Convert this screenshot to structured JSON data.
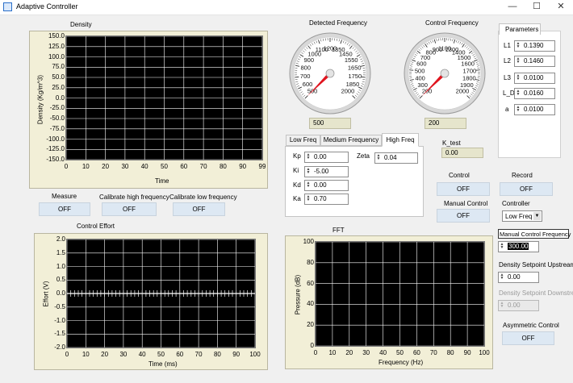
{
  "window": {
    "title": "Adaptive Controller",
    "minimize": "—",
    "maximize": "☐",
    "close": "✕"
  },
  "density_plot": {
    "title": "Density",
    "xlabel": "Time",
    "ylabel": "Density (Kg/m^3)",
    "yticks": [
      "150.0",
      "125.0",
      "100.0",
      "75.0",
      "50.0",
      "25.0",
      "0.0",
      "-25.0",
      "-50.0",
      "-75.0",
      "-100.0",
      "-125.0",
      "-150.0"
    ],
    "xticks": [
      "0",
      "10",
      "20",
      "30",
      "40",
      "50",
      "60",
      "70",
      "80",
      "90",
      "99"
    ]
  },
  "measure": {
    "label": "Measure",
    "value": "OFF"
  },
  "cal_high": {
    "label": "Calibrate high frequency",
    "value": "OFF"
  },
  "cal_low": {
    "label": "Calibrate low frequency",
    "value": "OFF"
  },
  "effort_plot": {
    "title": "Control Effort",
    "xlabel": "Time (ms)",
    "ylabel": "Effort (V)",
    "yticks": [
      "2.0",
      "1.5",
      "1.0",
      "0.5",
      "0.0",
      "-0.5",
      "-1.0",
      "-1.5",
      "-2.0"
    ],
    "xticks": [
      "0",
      "10",
      "20",
      "30",
      "40",
      "50",
      "60",
      "70",
      "80",
      "90",
      "100"
    ]
  },
  "fft_plot": {
    "title": "FFT",
    "xlabel": "Frequency (Hz)",
    "ylabel": "Pressure (dB)",
    "yticks": [
      "100",
      "80",
      "60",
      "40",
      "20",
      "0"
    ],
    "xticks": [
      "0",
      "10",
      "20",
      "30",
      "40",
      "50",
      "60",
      "70",
      "80",
      "90",
      "100"
    ]
  },
  "detected_gauge": {
    "title": "Detected Frequency",
    "scale": [
      "500",
      "600",
      "700",
      "800",
      "900",
      "1000",
      "1100",
      "1200",
      "1350",
      "1450",
      "1550",
      "1650",
      "1750",
      "1850",
      "2000"
    ],
    "readout": "500",
    "value": 500
  },
  "control_gauge": {
    "title": "Control Frequency",
    "scale": [
      "200",
      "300",
      "400",
      "500",
      "600",
      "700",
      "800",
      "900",
      "1100",
      "1300",
      "1400",
      "1500",
      "1600",
      "1700",
      "1800",
      "1900",
      "2000"
    ],
    "readout": "200",
    "value": 200
  },
  "tabs": {
    "items": [
      "Low Freq",
      "Medium Frequency",
      "High Freq"
    ],
    "active": 2,
    "kp": {
      "label": "Kp",
      "value": "0.00"
    },
    "ki": {
      "label": "Ki",
      "value": "-5.00"
    },
    "kd": {
      "label": "Kd",
      "value": "0.00"
    },
    "ka": {
      "label": "Ka",
      "value": "0.70"
    },
    "zeta": {
      "label": "Zeta",
      "value": "0.04"
    }
  },
  "k_test": {
    "label": "K_test",
    "value": "0.00"
  },
  "control": {
    "label": "Control",
    "value": "OFF"
  },
  "record": {
    "label": "Record",
    "value": "OFF"
  },
  "manual_control": {
    "label": "Manual Control",
    "value": "OFF"
  },
  "controller": {
    "label": "Controller",
    "value": "Low Freq"
  },
  "parameters": {
    "title": "Parameters",
    "items": [
      {
        "label": "L1",
        "value": "0.1390"
      },
      {
        "label": "L2",
        "value": "0.1460"
      },
      {
        "label": "L3",
        "value": "0.0100"
      },
      {
        "label": "L_D",
        "value": "0.0160"
      },
      {
        "label": "a",
        "value": "0.0100"
      }
    ]
  },
  "manual_freq": {
    "label": "Manual Control Frequency",
    "value": "300.00"
  },
  "setpoint_up": {
    "label": "Density Setpoint Upstream",
    "value": "0.00"
  },
  "setpoint_down": {
    "label": "Density Setpoint Downstream",
    "value": "0.00"
  },
  "asym": {
    "label": "Asymmetric Control",
    "value": "OFF"
  },
  "colors": {
    "plot_bg": "#000000",
    "grid": "#ffffff",
    "frame": "#f2efd7",
    "button": "#dde8f3",
    "needle": "#e0141e"
  }
}
